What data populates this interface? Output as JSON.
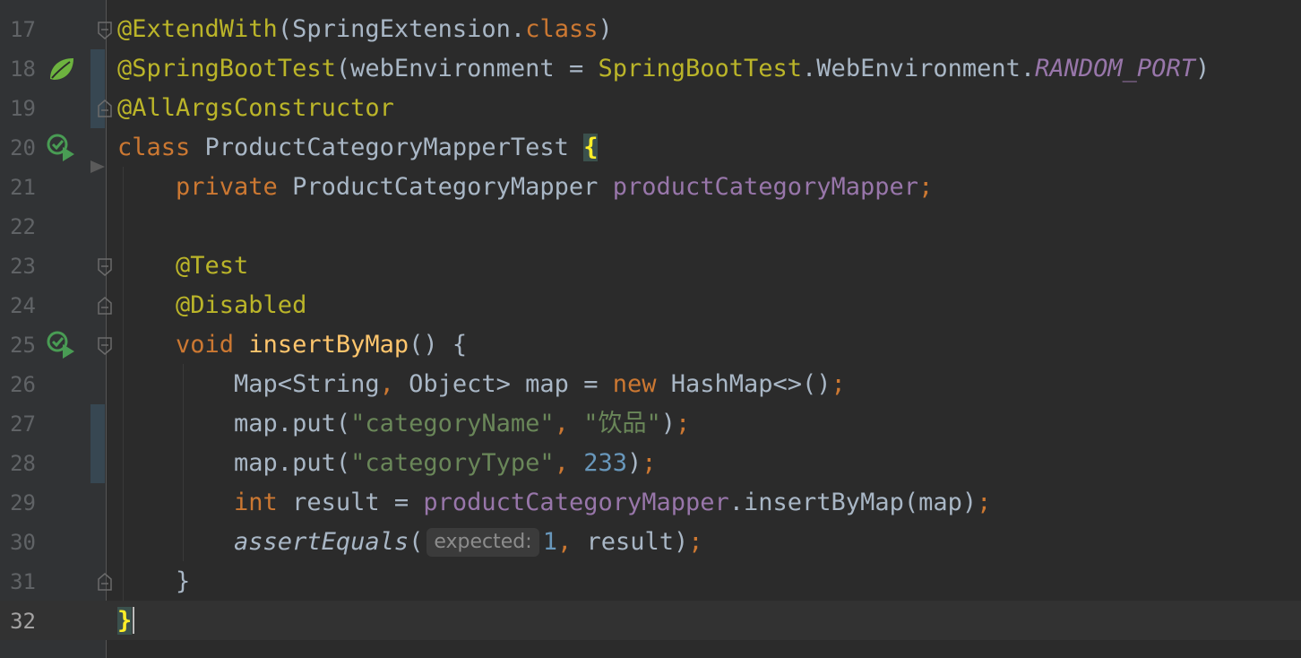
{
  "editor": {
    "current_line": "32",
    "lines": [
      {
        "num": "17",
        "tokens": [
          {
            "t": "@ExtendWith",
            "c": "ann"
          },
          {
            "t": "(",
            "c": "cls"
          },
          {
            "t": "SpringExtension",
            "c": "cls"
          },
          {
            "t": ".",
            "c": "cls"
          },
          {
            "t": "class",
            "c": "kw"
          },
          {
            "t": ")",
            "c": "cls"
          }
        ]
      },
      {
        "num": "18",
        "tokens": [
          {
            "t": "@SpringBootTest",
            "c": "ann"
          },
          {
            "t": "(",
            "c": "cls"
          },
          {
            "t": "webEnvironment",
            "c": "cls"
          },
          {
            "t": " = ",
            "c": "cls"
          },
          {
            "t": "SpringBootTest",
            "c": "ann"
          },
          {
            "t": ".WebEnvironment.",
            "c": "cls"
          },
          {
            "t": "RANDOM_PORT",
            "c": "fld-i"
          },
          {
            "t": ")",
            "c": "cls"
          }
        ]
      },
      {
        "num": "19",
        "tokens": [
          {
            "t": "@AllArgsConstructor",
            "c": "ann"
          }
        ]
      },
      {
        "num": "20",
        "tokens": [
          {
            "t": "class ",
            "c": "kw"
          },
          {
            "t": "ProductCategoryMapperTest ",
            "c": "cls"
          },
          {
            "t": "{",
            "c": "brace-hl"
          }
        ]
      },
      {
        "num": "21",
        "tokens": [
          {
            "t": "    private ",
            "c": "kw"
          },
          {
            "t": "ProductCategoryMapper ",
            "c": "cls"
          },
          {
            "t": "productCategoryMapper",
            "c": "fld"
          },
          {
            "t": ";",
            "c": "kw"
          }
        ]
      },
      {
        "num": "22",
        "tokens": []
      },
      {
        "num": "23",
        "tokens": [
          {
            "t": "    @Test",
            "c": "ann"
          }
        ]
      },
      {
        "num": "24",
        "tokens": [
          {
            "t": "    @Disabled",
            "c": "ann"
          }
        ]
      },
      {
        "num": "25",
        "tokens": [
          {
            "t": "    void ",
            "c": "kw"
          },
          {
            "t": "insertByMap",
            "c": "fn"
          },
          {
            "t": "() {",
            "c": "cls"
          }
        ]
      },
      {
        "num": "26",
        "tokens": [
          {
            "t": "        Map<String",
            "c": "cls"
          },
          {
            "t": ", ",
            "c": "kw"
          },
          {
            "t": "Object> map = ",
            "c": "cls"
          },
          {
            "t": "new ",
            "c": "kw"
          },
          {
            "t": "HashMap<>()",
            "c": "cls"
          },
          {
            "t": ";",
            "c": "kw"
          }
        ]
      },
      {
        "num": "27",
        "tokens": [
          {
            "t": "        map.put(",
            "c": "cls"
          },
          {
            "t": "\"categoryName\"",
            "c": "str"
          },
          {
            "t": ", ",
            "c": "kw"
          },
          {
            "t": "\"饮品\"",
            "c": "str"
          },
          {
            "t": ")",
            "c": "cls"
          },
          {
            "t": ";",
            "c": "kw"
          }
        ]
      },
      {
        "num": "28",
        "tokens": [
          {
            "t": "        map.put(",
            "c": "cls"
          },
          {
            "t": "\"categoryType\"",
            "c": "str"
          },
          {
            "t": ", ",
            "c": "kw"
          },
          {
            "t": "233",
            "c": "num"
          },
          {
            "t": ")",
            "c": "cls"
          },
          {
            "t": ";",
            "c": "kw"
          }
        ]
      },
      {
        "num": "29",
        "tokens": [
          {
            "t": "        int ",
            "c": "kw"
          },
          {
            "t": "result = ",
            "c": "cls"
          },
          {
            "t": "productCategoryMapper",
            "c": "fld"
          },
          {
            "t": ".insertByMap(map)",
            "c": "cls"
          },
          {
            "t": ";",
            "c": "kw"
          }
        ]
      },
      {
        "num": "30",
        "tokens": [
          {
            "t": "        assertEquals",
            "c": "it"
          },
          {
            "t": "(",
            "c": "cls"
          },
          {
            "t": "expected:",
            "c": "hint"
          },
          {
            "t": "1",
            "c": "num"
          },
          {
            "t": ", ",
            "c": "kw"
          },
          {
            "t": "result)",
            "c": "cls"
          },
          {
            "t": ";",
            "c": "kw"
          }
        ]
      },
      {
        "num": "31",
        "tokens": [
          {
            "t": "    }",
            "c": "cls"
          }
        ]
      },
      {
        "num": "32",
        "tokens": [
          {
            "t": "}",
            "c": "brace-end"
          },
          {
            "t": "",
            "c": "caret"
          }
        ]
      }
    ]
  },
  "gutter_icons": {
    "spring_bean": "spring-leaf-icon",
    "run_test": "run-test-icon",
    "fold": "fold-marker-icon"
  },
  "colors": {
    "background": "#2b2b2b",
    "gutter": "#313335",
    "keyword": "#cc7832",
    "annotation": "#bbb529",
    "string": "#6a8759",
    "number": "#6897bb",
    "field": "#9876aa",
    "method": "#ffc66d"
  }
}
